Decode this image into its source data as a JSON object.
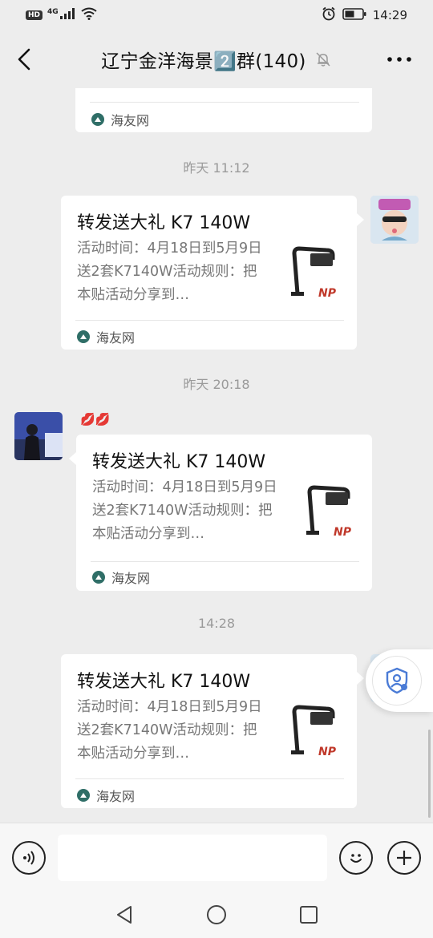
{
  "status_bar": {
    "hd": "HD",
    "network": "4G",
    "time": "14:29"
  },
  "header": {
    "title": "辽宁金洋海景2️⃣群(140)",
    "back_icon": "chevron-left-icon",
    "mute_icon": "bell-off-icon",
    "more_icon": "more-horizontal-icon"
  },
  "messages": [
    {
      "type": "card-partial",
      "source": "海友网"
    },
    {
      "type": "time",
      "text": "昨天 11:12"
    },
    {
      "type": "card",
      "side": "right",
      "title": "转发送大礼 K7 140W",
      "desc": "活动时间：4月18日到5月9日送2套K7140W活动规则：把本贴活动分享到…",
      "source": "海友网"
    },
    {
      "type": "time",
      "text": "昨天 20:18"
    },
    {
      "type": "card",
      "side": "left",
      "sender_tag": "💋💋",
      "title": "转发送大礼 K7 140W",
      "desc": "活动时间：4月18日到5月9日送2套K7140W活动规则：把本贴活动分享到…",
      "source": "海友网"
    },
    {
      "type": "time",
      "text": "14:28"
    },
    {
      "type": "card",
      "side": "right",
      "title": "转发送大礼 K7 140W",
      "desc": "活动时间：4月18日到5月9日送2套K7140W活动规则：把本贴活动分享到…",
      "source": "海友网"
    }
  ],
  "input_bar": {
    "placeholder": "",
    "voice_icon": "voice-icon",
    "emoji_icon": "emoji-icon",
    "plus_icon": "plus-icon"
  },
  "nav_bar": {
    "back_icon": "nav-back-icon",
    "home_icon": "nav-home-icon",
    "recents_icon": "nav-recents-icon"
  },
  "colors": {
    "background": "#ededed",
    "card": "#ffffff",
    "text_primary": "#111111",
    "text_secondary": "#777777",
    "timestamp": "#9a9a9a",
    "source_icon": "#2f6e67"
  }
}
